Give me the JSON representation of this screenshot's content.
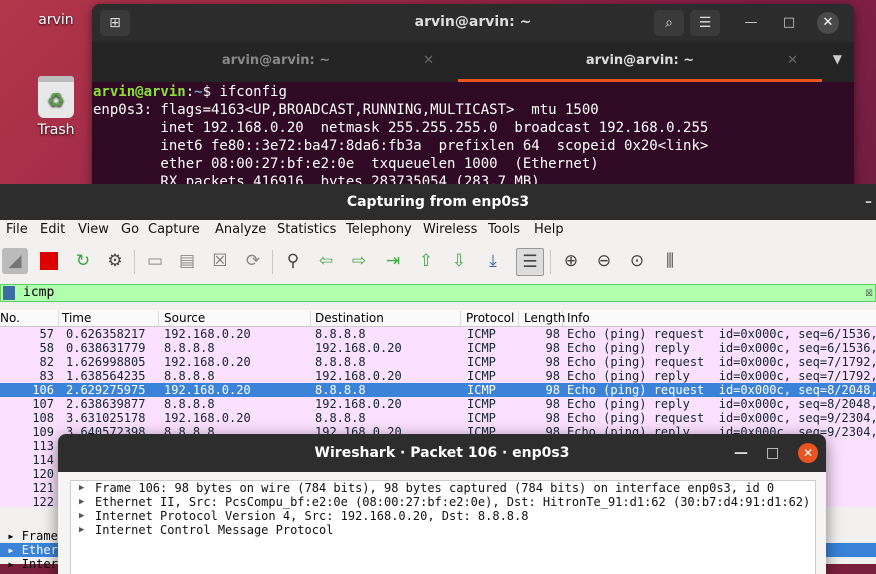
{
  "desktop": {
    "top_icon_label": "arvin",
    "trash_label": "Trash"
  },
  "terminal": {
    "title": "arvin@arvin: ~",
    "tabs": [
      {
        "label": "arvin@arvin: ~",
        "active": false
      },
      {
        "label": "arvin@arvin: ~",
        "active": true
      }
    ],
    "prompt_user": "arvin@arvin",
    "prompt_sep": ":",
    "prompt_path": "~",
    "prompt_end": "$ ",
    "command": "ifconfig",
    "output": [
      "enp0s3: flags=4163<UP,BROADCAST,RUNNING,MULTICAST>  mtu 1500",
      "        inet 192.168.0.20  netmask 255.255.255.0  broadcast 192.168.0.255",
      "        inet6 fe80::3e72:ba47:8da6:fb3a  prefixlen 64  scopeid 0x20<link>",
      "        ether 08:00:27:bf:e2:0e  txqueuelen 1000  (Ethernet)",
      "        RX packets 416916  bytes 283735054 (283.7 MB)"
    ]
  },
  "wireshark": {
    "title": "Capturing from enp0s3",
    "menu": [
      "File",
      "Edit",
      "View",
      "Go",
      "Capture",
      "Analyze",
      "Statistics",
      "Telephony",
      "Wireless",
      "Tools",
      "Help"
    ],
    "filter": "icmp",
    "columns": [
      "No.",
      "Time",
      "Source",
      "Destination",
      "Protocol",
      "Length",
      "Info"
    ],
    "packets": [
      {
        "no": "57",
        "time": "0.626358217",
        "src": "192.168.0.20",
        "dst": "8.8.8.8",
        "proto": "ICMP",
        "len": "98",
        "info": "Echo (ping) request  id=0x000c, seq=6/1536,",
        "sel": false
      },
      {
        "no": "58",
        "time": "0.638631779",
        "src": "8.8.8.8",
        "dst": "192.168.0.20",
        "proto": "ICMP",
        "len": "98",
        "info": "Echo (ping) reply    id=0x000c, seq=6/1536,",
        "sel": false
      },
      {
        "no": "82",
        "time": "1.626998805",
        "src": "192.168.0.20",
        "dst": "8.8.8.8",
        "proto": "ICMP",
        "len": "98",
        "info": "Echo (ping) request  id=0x000c, seq=7/1792,",
        "sel": false
      },
      {
        "no": "83",
        "time": "1.638564235",
        "src": "8.8.8.8",
        "dst": "192.168.0.20",
        "proto": "ICMP",
        "len": "98",
        "info": "Echo (ping) reply    id=0x000c, seq=7/1792,",
        "sel": false
      },
      {
        "no": "106",
        "time": "2.629275975",
        "src": "192.168.0.20",
        "dst": "8.8.8.8",
        "proto": "ICMP",
        "len": "98",
        "info": "Echo (ping) request  id=0x000c, seq=8/2048,",
        "sel": true
      },
      {
        "no": "107",
        "time": "2.638639877",
        "src": "8.8.8.8",
        "dst": "192.168.0.20",
        "proto": "ICMP",
        "len": "98",
        "info": "Echo (ping) reply    id=0x000c, seq=8/2048,",
        "sel": false
      },
      {
        "no": "108",
        "time": "3.631025178",
        "src": "192.168.0.20",
        "dst": "8.8.8.8",
        "proto": "ICMP",
        "len": "98",
        "info": "Echo (ping) request  id=0x000c, seq=9/2304,",
        "sel": false
      },
      {
        "no": "109",
        "time": "3.640572398",
        "src": "8.8.8.8",
        "dst": "192.168.0.20",
        "proto": "ICMP",
        "len": "98",
        "info": "Echo (ping) reply    id=0x000c, seq=9/2304,",
        "sel": false
      },
      {
        "no": "113",
        "time": "",
        "src": "",
        "dst": "",
        "proto": "",
        "len": "",
        "info": "10/2560",
        "sel": false
      },
      {
        "no": "114",
        "time": "",
        "src": "",
        "dst": "",
        "proto": "",
        "len": "",
        "info": "10/2560",
        "sel": false
      },
      {
        "no": "120",
        "time": "",
        "src": "",
        "dst": "",
        "proto": "",
        "len": "",
        "info": "11/2816",
        "sel": false
      },
      {
        "no": "121",
        "time": "",
        "src": "",
        "dst": "",
        "proto": "",
        "len": "",
        "info": "11/2816",
        "sel": false
      },
      {
        "no": "122",
        "time": "",
        "src": "",
        "dst": "",
        "proto": "",
        "len": "",
        "info": "12/3072",
        "sel": false
      },
      {
        "no": "131",
        "time": "",
        "src": "",
        "dst": "",
        "proto": "",
        "len": "",
        "info": "",
        "sel": false
      }
    ],
    "details_under": [
      "Frame",
      "Ether",
      "Inter"
    ]
  },
  "dialog": {
    "title": "Wireshark · Packet 106 · enp0s3",
    "rows": [
      "Frame 106: 98 bytes on wire (784 bits), 98 bytes captured (784 bits) on interface enp0s3, id 0",
      "Ethernet II, Src: PcsCompu_bf:e2:0e (08:00:27:bf:e2:0e), Dst: HitronTe_91:d1:62 (30:b7:d4:91:d1:62)",
      "Internet Protocol Version 4, Src: 192.168.0.20, Dst: 8.8.8.8",
      "Internet Control Message Protocol"
    ]
  }
}
